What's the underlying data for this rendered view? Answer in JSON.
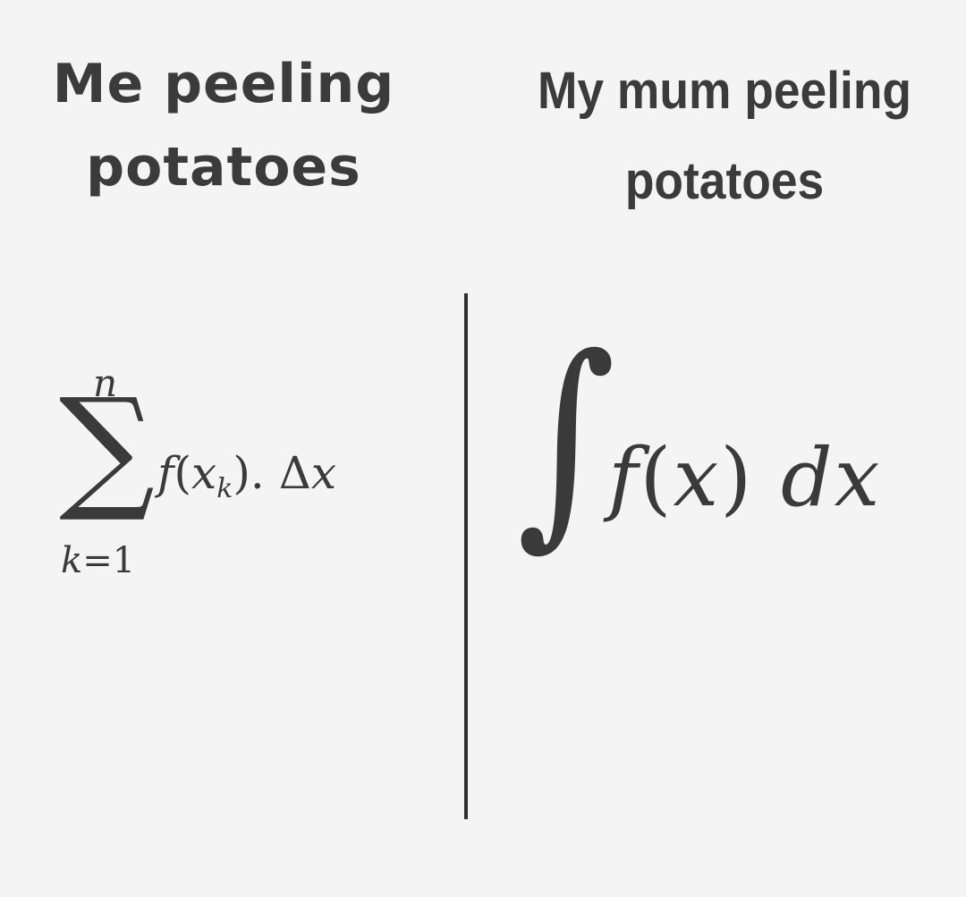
{
  "captions": {
    "left_line1": "Me peeling",
    "left_line2": "potatoes",
    "right_line1": "My mum peeling",
    "right_line2": "potatoes"
  },
  "sum_formula": {
    "upper_limit": "n",
    "sign": "∑",
    "lower_var": "k",
    "lower_eq": "=1",
    "func": "f",
    "open_paren": "(",
    "var": "x",
    "subscript": "k",
    "close": ").",
    "delta": "Δ",
    "delta_var": "x"
  },
  "integral_formula": {
    "sign": "∫",
    "func": "f",
    "open_paren": "(",
    "var": "x",
    "close_paren": ")",
    "d": "d",
    "dvar": "x"
  },
  "colors": {
    "background": "#f4f4f4",
    "text": "#3a3a3a",
    "divider": "#2f2f2f"
  }
}
